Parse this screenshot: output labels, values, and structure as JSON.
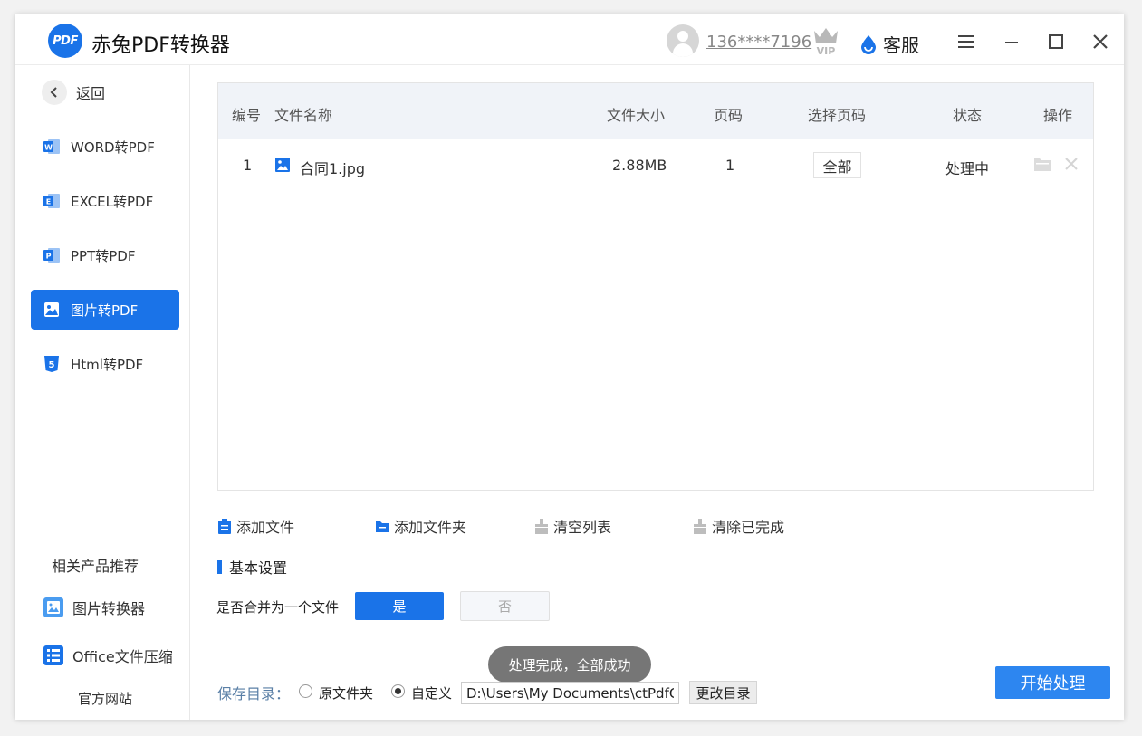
{
  "app": {
    "logo_text": "PDF",
    "title": "赤兔PDF转换器"
  },
  "header": {
    "phone": "136****7196",
    "vip_label": "VIP",
    "service_label": "客服"
  },
  "sidebar": {
    "back_label": "返回",
    "items": [
      {
        "label": "WORD转PDF",
        "icon": "word-icon",
        "active": false
      },
      {
        "label": "EXCEL转PDF",
        "icon": "excel-icon",
        "active": false
      },
      {
        "label": "PPT转PDF",
        "icon": "ppt-icon",
        "active": false
      },
      {
        "label": "图片转PDF",
        "icon": "image-icon",
        "active": true
      },
      {
        "label": "Html转PDF",
        "icon": "html5-icon",
        "active": false
      }
    ],
    "recommend_title": "相关产品推荐",
    "recommend": [
      {
        "label": "图片转换器",
        "icon": "image-converter-icon"
      },
      {
        "label": "Office文件压缩",
        "icon": "office-compress-icon"
      }
    ],
    "website_label": "官方网站"
  },
  "table": {
    "columns": [
      "编号",
      "文件名称",
      "文件大小",
      "页码",
      "选择页码",
      "状态",
      "操作"
    ],
    "rows": [
      {
        "index": "1",
        "name": "合同1.jpg",
        "size": "2.88MB",
        "pages": "1",
        "page_select": "全部",
        "status": "处理中"
      }
    ]
  },
  "toolbar": {
    "add_file": "添加文件",
    "add_folder": "添加文件夹",
    "clear_list": "清空列表",
    "clear_done": "清除已完成"
  },
  "settings": {
    "title": "基本设置",
    "merge_label": "是否合并为一个文件",
    "yes": "是",
    "no": "否",
    "merge_selected": "是"
  },
  "toast": "处理完成，全部成功",
  "save": {
    "label": "保存目录：",
    "option_original": "原文件夹",
    "option_custom": "自定义",
    "selected": "自定义",
    "path": "D:\\Users\\My Documents\\ctPdfCon",
    "change_button": "更改目录"
  },
  "start_button": "开始处理",
  "colors": {
    "accent": "#1a73e8",
    "start": "#2d86f0",
    "toast_bg": "#767676"
  }
}
